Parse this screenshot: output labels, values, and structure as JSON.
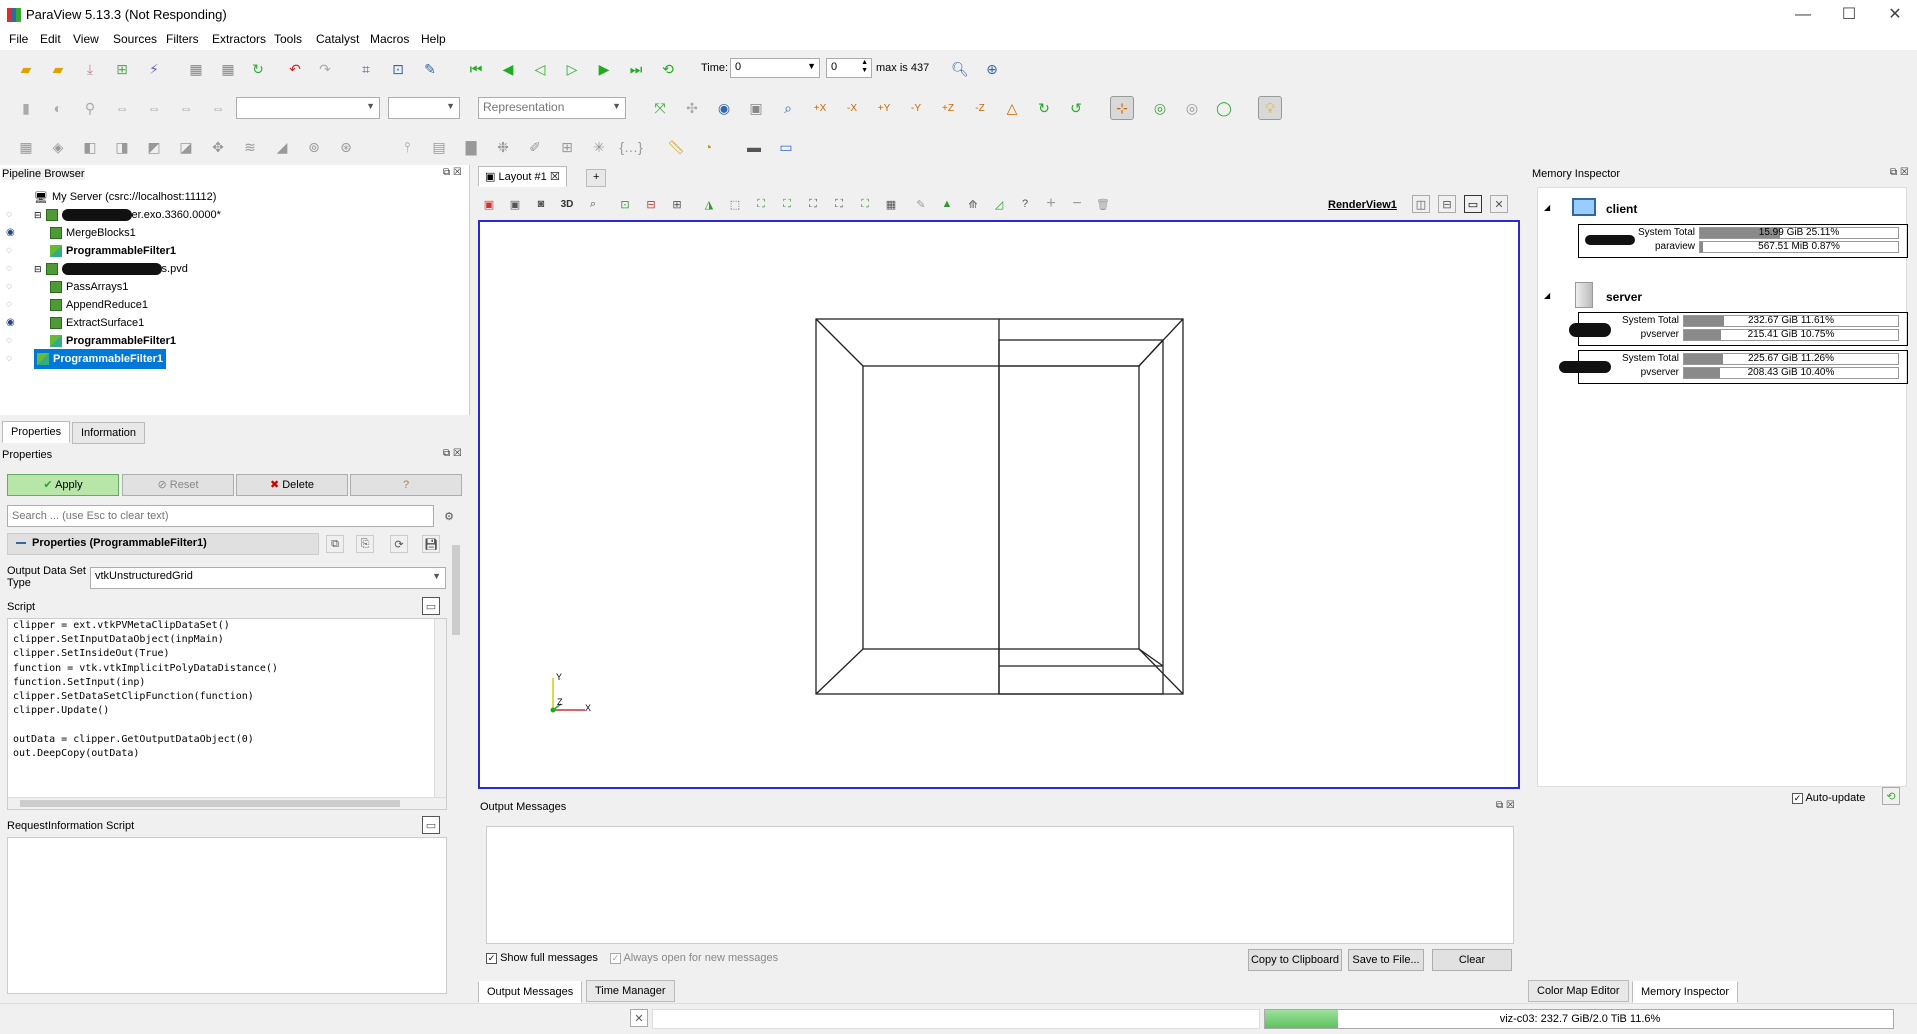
{
  "window": {
    "title": "ParaView 5.13.3 (Not Responding)"
  },
  "menu": [
    "File",
    "Edit",
    "View",
    "Sources",
    "Filters",
    "Extractors",
    "Tools",
    "Catalyst",
    "Macros",
    "Help"
  ],
  "toolbar": {
    "time_label": "Time:",
    "time_value": "0",
    "timestep_value": "0",
    "max_label": "max is 437",
    "representation": "Representation"
  },
  "pipeline": {
    "title": "Pipeline Browser",
    "server": "My Server (csrc://localhost:11112)",
    "items": [
      {
        "label": "er.exo.3360.0000*",
        "bold": false
      },
      {
        "label": "MergeBlocks1",
        "bold": false
      },
      {
        "label": "ProgrammableFilter1",
        "bold": true
      },
      {
        "label": "s.pvd",
        "bold": false
      },
      {
        "label": "PassArrays1",
        "bold": false
      },
      {
        "label": "AppendReduce1",
        "bold": false
      },
      {
        "label": "ExtractSurface1",
        "bold": false
      },
      {
        "label": "ProgrammableFilter1",
        "bold": true
      },
      {
        "label": "ProgrammableFilter1",
        "bold": true,
        "selected": true
      }
    ]
  },
  "props": {
    "tab_properties": "Properties",
    "tab_information": "Information",
    "panel_title": "Properties",
    "apply": "Apply",
    "reset": "Reset",
    "delete": "Delete",
    "help": "?",
    "search_placeholder": "Search ... (use Esc to clear text)",
    "section": "Properties (ProgrammableFilter1)",
    "output_type_label": "Output Data Set Type",
    "output_type_value": "vtkUnstructuredGrid",
    "script_label": "Script",
    "script_lines": [
      "clipper = ext.vtkPVMetaClipDataSet()",
      "clipper.SetInputDataObject(inpMain)",
      "clipper.SetInsideOut(True)",
      "function = vtk.vtkImplicitPolyDataDistance()",
      "function.SetInput(inp)",
      "clipper.SetDataSetClipFunction(function)",
      "clipper.Update()",
      "",
      "outData = clipper.GetOutputDataObject(0)",
      "out.DeepCopy(outData)"
    ],
    "reqinfo_label": "RequestInformation Script"
  },
  "layout": {
    "tab": "Layout #1",
    "add": "+",
    "render_view": "RenderView1",
    "btn_3d": "3D"
  },
  "output": {
    "title": "Output Messages",
    "show_full": "Show full messages",
    "always_open": "Always open for new messages",
    "copy": "Copy to Clipboard",
    "save": "Save to File...",
    "clear": "Clear"
  },
  "bottom_tabs": {
    "output": "Output Messages",
    "time": "Time Manager",
    "colormap": "Color Map Editor",
    "memory": "Memory Inspector"
  },
  "memory": {
    "title": "Memory Inspector",
    "client": "client",
    "server": "server",
    "client_rows": [
      {
        "label": "System Total",
        "value": "15.99 GiB 25.11%",
        "pct": 0.2511
      },
      {
        "label": "paraview",
        "value": "567.51 MiB 0.87%",
        "pct": 0.0087
      }
    ],
    "server1_rows": [
      {
        "label": "System Total",
        "value": "232.67 GiB 11.61%",
        "pct": 0.1161
      },
      {
        "label": "pvserver",
        "value": "215.41 GiB 10.75%",
        "pct": 0.1075
      }
    ],
    "server2_rows": [
      {
        "label": "System Total",
        "value": "225.67 GiB 11.26%",
        "pct": 0.1126
      },
      {
        "label": "pvserver",
        "value": "208.43 GiB 10.40%",
        "pct": 0.104
      }
    ],
    "auto_update": "Auto-update"
  },
  "status": {
    "memory_text": "viz-c03: 232.7 GiB/2.0 TiB 11.6%",
    "memory_fraction": 0.116
  },
  "axes": {
    "x": "X",
    "y": "Y",
    "z": "Z"
  }
}
